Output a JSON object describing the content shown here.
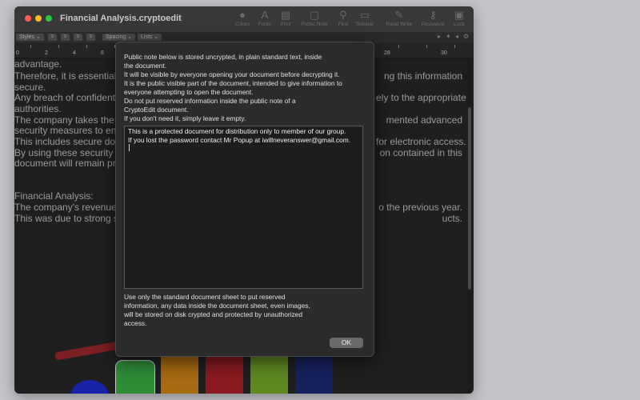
{
  "window": {
    "title": "Financial Analysis.cryptoedit"
  },
  "toolbar": {
    "items": [
      {
        "label": "Colors",
        "icon": "palette-icon"
      },
      {
        "label": "Fonts",
        "icon": "font-icon"
      },
      {
        "label": "Print",
        "icon": "printer-icon"
      },
      {
        "label": "Public Note",
        "icon": "note-icon"
      },
      {
        "label": "Find",
        "icon": "magnifier-icon"
      },
      {
        "label": "Sidebar",
        "icon": "sidebar-icon"
      },
      {
        "label": "Read Write",
        "icon": "pencil-icon"
      },
      {
        "label": "Password",
        "icon": "key-icon"
      },
      {
        "label": "Lock",
        "icon": "lock-icon"
      }
    ]
  },
  "format_bar": {
    "styles": "Styles",
    "spacing": "Spacing",
    "lists": "Lists"
  },
  "ruler": {
    "numbers": [
      "0",
      "2",
      "4",
      "6",
      "8",
      "28",
      "30"
    ]
  },
  "document": {
    "lines": [
      {
        "left": "advantage.",
        "right": ""
      },
      {
        "left": "Therefore, it is essential t",
        "right": "ng this information"
      },
      {
        "left": "secure.",
        "right": ""
      },
      {
        "left": "Any breach of confidential",
        "right": "ely to the appropriate"
      },
      {
        "left": "authorities.",
        "right": ""
      },
      {
        "left": "The company takes the p",
        "right": "mented advanced"
      },
      {
        "left": "security measures to ens",
        "right": ""
      },
      {
        "left": "This includes secure doc",
        "right": "for electronic access."
      },
      {
        "left": "By using these security m",
        "right": "on contained in this"
      },
      {
        "left": "document will remain pro",
        "right": ""
      },
      {
        "left": "",
        "right": ""
      },
      {
        "left": "",
        "right": ""
      },
      {
        "left": "Financial Analysis:",
        "right": ""
      },
      {
        "left": "The company's revenue i",
        "right": "o the previous year."
      },
      {
        "left": "This was due to strong sa",
        "right": "ucts."
      }
    ]
  },
  "sheet": {
    "intro_lines": [
      "Public note below is stored uncrypted, in plain standard text, inside",
      "the document.",
      "It will be visible by everyone opening your document before decrypting it.",
      "It is the public visible part of the document, intended to give information to",
      "everyone attempting to open the document.",
      "Do not put reserved information inside the public note of a",
      "CryptoEdit document.",
      "If you don't need it, simply leave it empty."
    ],
    "note_lines": [
      "This is a  protected document for distribution only to member of our group.",
      "If you lost the password contact Mr Popup at iwillneveranswer@gmail.com."
    ],
    "footer_lines": [
      "Use only the standard document sheet to put reserved",
      "information, any data inside the document sheet, even images,",
      "will be stored on disk crypted and protected by unauthorized",
      "access."
    ],
    "ok_label": "OK"
  },
  "colors": {
    "swatches": [
      "#1a24a8",
      "#2d8c36",
      "#a86a12",
      "#8a1a20",
      "#5e8a22",
      "#16225e"
    ]
  }
}
